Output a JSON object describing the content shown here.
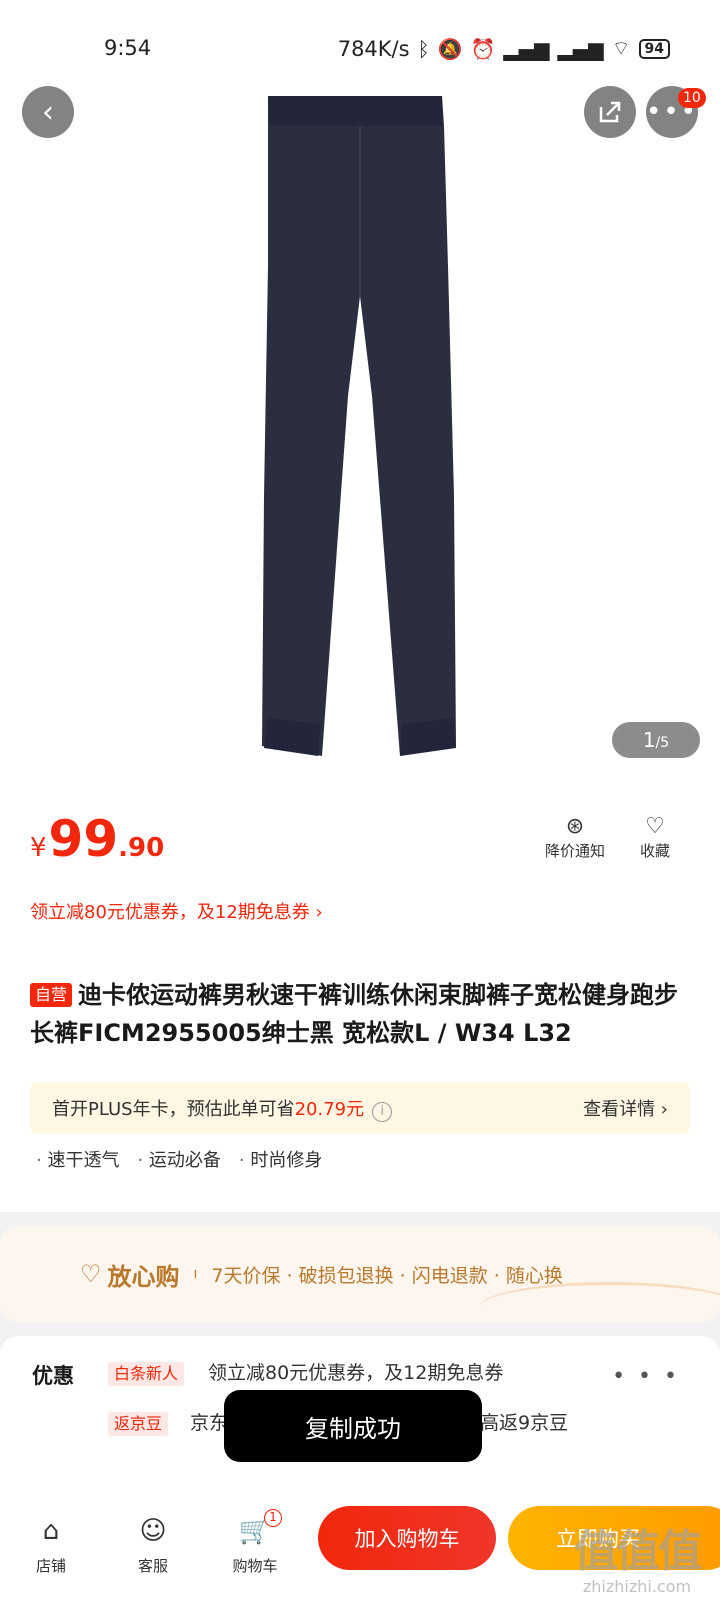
{
  "status_bar": {
    "time": "9:54",
    "speed": "784K/s",
    "battery": "94"
  },
  "header": {
    "more_badge": "10"
  },
  "gallery": {
    "current": "1",
    "total": "/5"
  },
  "price": {
    "currency": "¥",
    "integer": "99",
    "decimal": ".90"
  },
  "actions": {
    "price_alert": "降价通知",
    "favorite": "收藏"
  },
  "coupon_line": "领立减80元优惠券，及12期免息券 ›",
  "product": {
    "self_tag": "自营",
    "title": "迪卡侬运动裤男秋速干裤训练休闲束脚裤子宽松健身跑步长裤FICM2955005绅士黑 宽松款L / W34 L32"
  },
  "plus": {
    "text": "首开PLUS年卡，预估此单可省",
    "amount": "20.79元",
    "info": "i",
    "link": "查看详情 ›"
  },
  "features": [
    "速干透气",
    "运动必备",
    "时尚修身"
  ],
  "assurance": {
    "brand": "放心购",
    "items": "7天价保 · 破损包退换 · 闪电退款 · 随心换"
  },
  "promo": {
    "title": "优惠",
    "rows": [
      {
        "tag": "白条新人",
        "text": "领立减80元优惠券，及12期免息券"
      },
      {
        "tag": "返京豆",
        "text": "京东",
        "text_tail": "高返9京豆"
      }
    ],
    "more": "• • •"
  },
  "toast": "复制成功",
  "bottom": {
    "store": "店铺",
    "service": "客服",
    "cart": "购物车",
    "cart_badge": "1",
    "add_to_cart": "加入购物车",
    "buy_now": "立即购买"
  },
  "watermark": {
    "big": "值值值",
    "small": "zhizhizhi.com"
  },
  "colors": {
    "accent": "#f2270c",
    "buy": "#ffa800",
    "assure": "#b9782c",
    "pants": "#2b2e3f"
  }
}
